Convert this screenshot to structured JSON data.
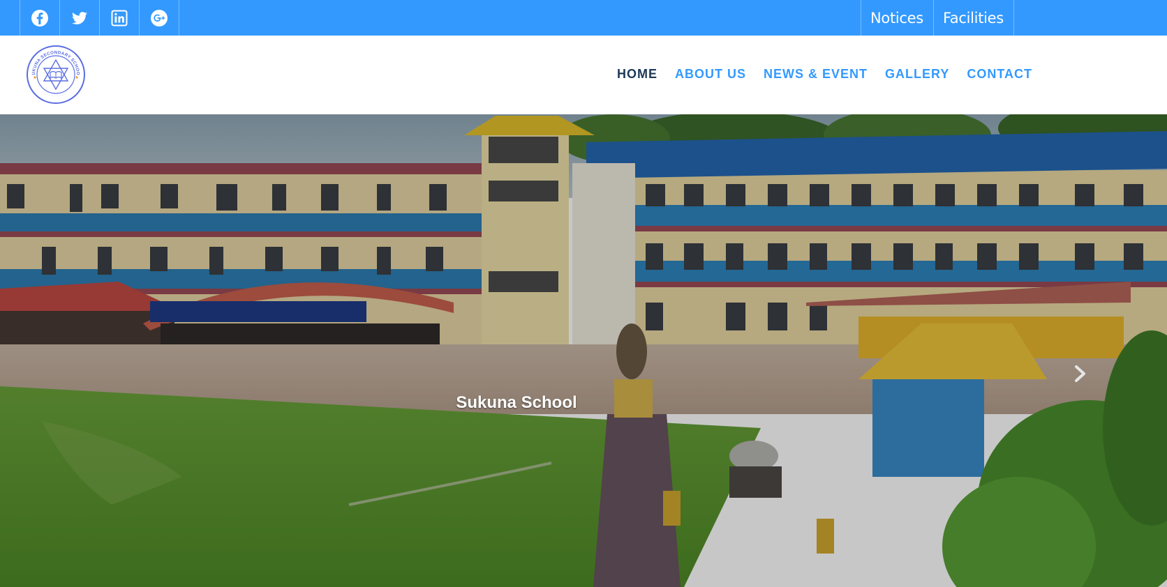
{
  "topbar": {
    "social": [
      {
        "name": "facebook-icon"
      },
      {
        "name": "twitter-icon"
      },
      {
        "name": "linkedin-icon"
      },
      {
        "name": "google-plus-icon"
      }
    ],
    "links": [
      "Notices",
      "Facilities"
    ]
  },
  "header": {
    "logo_text": "SUKUNA SECONDARY SCHOOL",
    "nav": [
      {
        "label": "HOME",
        "active": true
      },
      {
        "label": "ABOUT US",
        "active": false
      },
      {
        "label": "NEWS & EVENT",
        "active": false
      },
      {
        "label": "GALLERY",
        "active": false
      },
      {
        "label": "CONTACT",
        "active": false
      }
    ]
  },
  "hero": {
    "caption": "Sukuna School",
    "next_icon": "chevron-right-icon"
  },
  "colors": {
    "brand_blue": "#3399ff",
    "nav_active": "#1d3857"
  }
}
